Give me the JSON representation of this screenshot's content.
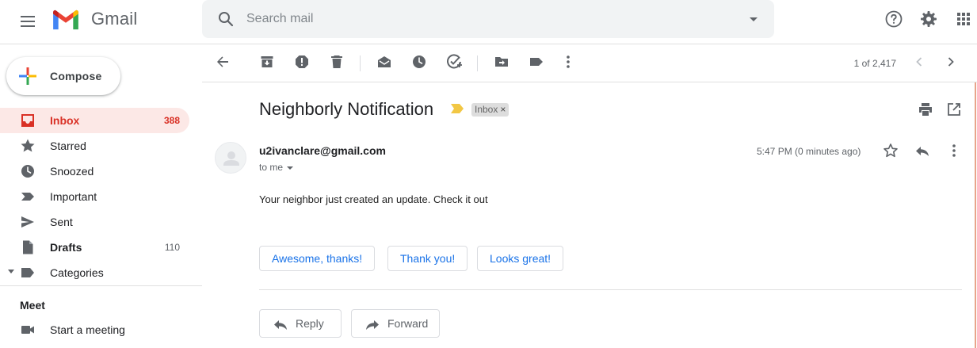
{
  "app": {
    "name": "Gmail",
    "colors": {
      "accent_red": "#d93025",
      "active_bg": "#fce8e6",
      "link_blue": "#1a73e8"
    }
  },
  "header": {
    "logo_text": "Gmail",
    "search": {
      "placeholder": "Search mail",
      "value": ""
    },
    "icons": [
      "menu-icon",
      "search-icon",
      "search-options-icon",
      "help-icon",
      "settings-icon",
      "apps-icon"
    ]
  },
  "sidebar": {
    "compose_label": "Compose",
    "items": [
      {
        "label": "Inbox",
        "count": "388",
        "icon": "inbox-icon",
        "active": true
      },
      {
        "label": "Starred",
        "count": "",
        "icon": "star-icon"
      },
      {
        "label": "Snoozed",
        "count": "",
        "icon": "clock-icon"
      },
      {
        "label": "Important",
        "count": "",
        "icon": "important-icon"
      },
      {
        "label": "Sent",
        "count": "",
        "icon": "send-icon"
      },
      {
        "label": "Drafts",
        "count": "110",
        "icon": "draft-icon",
        "bold": true
      },
      {
        "label": "Categories",
        "count": "",
        "icon": "label-icon"
      }
    ],
    "meet": {
      "title": "Meet",
      "items": [
        {
          "label": "Start a meeting",
          "icon": "video-icon"
        }
      ]
    }
  },
  "toolbar": {
    "icons": [
      "back-icon",
      "archive-icon",
      "report-spam-icon",
      "delete-icon",
      "mark-unread-icon",
      "snooze-icon",
      "add-task-icon",
      "move-to-icon",
      "labels-icon",
      "more-icon"
    ],
    "pager": "1 of 2,417"
  },
  "message": {
    "subject": "Neighborly Notification",
    "label_chip": "Inbox",
    "label_chip_close": "×",
    "sender": "u2ivanclare@gmail.com",
    "recipient": "to me",
    "timestamp": "5:47 PM (0 minutes ago)",
    "body": "Your neighbor just created an update. Check it out",
    "smart_replies": [
      "Awesome, thanks!",
      "Thank you!",
      "Looks great!"
    ],
    "reply_label": "Reply",
    "forward_label": "Forward"
  }
}
